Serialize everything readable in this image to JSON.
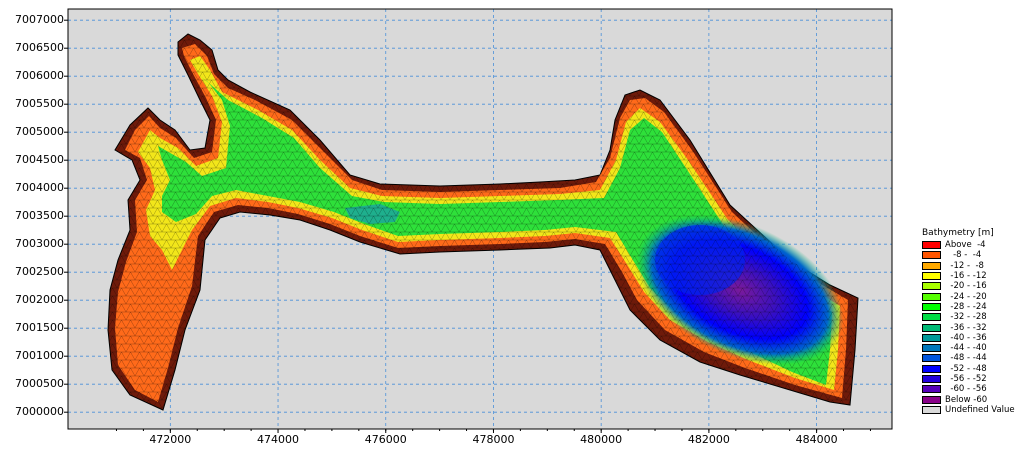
{
  "map": {
    "y_ticks": [
      "7007000",
      "7006500",
      "7006000",
      "7005500",
      "7005000",
      "7004500",
      "7004000",
      "7003500",
      "7003000",
      "7002500",
      "7002000",
      "7001500",
      "7001000",
      "7000500",
      "7000000"
    ],
    "x_ticks": [
      "472000",
      "474000",
      "476000",
      "478000",
      "480000",
      "482000",
      "484000"
    ],
    "y_tick_values": [
      7007000,
      7006500,
      7006000,
      7005500,
      7005000,
      7004500,
      7004000,
      7003500,
      7003000,
      7002500,
      7002000,
      7001500,
      7001000,
      7000500,
      7000000
    ],
    "x_tick_values": [
      472000,
      474000,
      476000,
      478000,
      480000,
      482000,
      484000
    ],
    "x_range": [
      470100,
      485400
    ],
    "y_range": [
      6999700,
      7007200
    ],
    "grid": true,
    "grid_color": "#4a90d9",
    "background_color": "#d9d9d9",
    "mesh_color": "#000000"
  },
  "legend": {
    "title": "Bathymetry [m]",
    "items": [
      {
        "label": "Above  -4",
        "color": "#ff0000"
      },
      {
        "label": "   -8 -  -4",
        "color": "#ff5500"
      },
      {
        "label": "  -12 -  -8",
        "color": "#ffaa00"
      },
      {
        "label": "  -16 - -12",
        "color": "#ffff00"
      },
      {
        "label": "  -20 - -16",
        "color": "#aaff00"
      },
      {
        "label": "  -24 - -20",
        "color": "#55ff00"
      },
      {
        "label": "  -28 - -24",
        "color": "#00ff00"
      },
      {
        "label": "  -32 - -28",
        "color": "#00dd44"
      },
      {
        "label": "  -36 - -32",
        "color": "#00bb77"
      },
      {
        "label": "  -40 - -36",
        "color": "#009999"
      },
      {
        "label": "  -44 - -40",
        "color": "#0077bb"
      },
      {
        "label": "  -48 - -44",
        "color": "#0055dd"
      },
      {
        "label": "  -52 - -48",
        "color": "#0000ff"
      },
      {
        "label": "  -56 - -52",
        "color": "#2200dd"
      },
      {
        "label": "  -60 - -56",
        "color": "#5500bb"
      },
      {
        "label": "Below -60",
        "color": "#880088"
      },
      {
        "label": "Undefined Value",
        "color": "#d9d9d9"
      }
    ]
  }
}
